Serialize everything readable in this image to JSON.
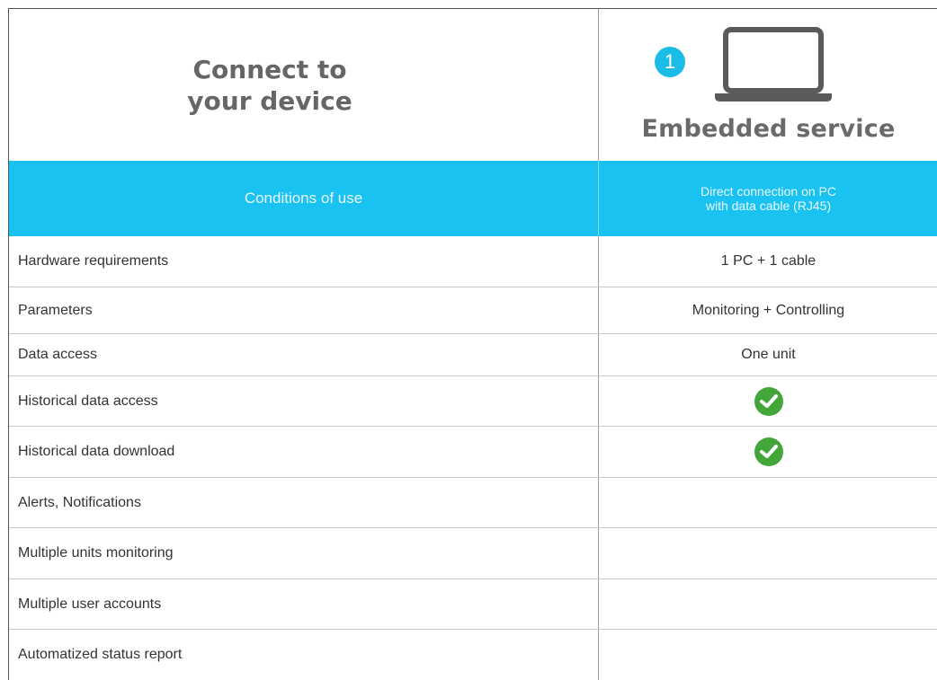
{
  "header": {
    "title_line1": "Connect to",
    "title_line2": "your device",
    "badge_number": "1",
    "service_title": "Embedded service",
    "service_icon": "laptop-icon",
    "accent_color": "#1ac2f1"
  },
  "conditions": {
    "label": "Conditions of use",
    "value_line1": "Direct connection on PC",
    "value_line2": "with data cable (RJ45)"
  },
  "rows": [
    {
      "label": "Hardware requirements",
      "value": "1 PC + 1 cable"
    },
    {
      "label": "Parameters",
      "value": "Monitoring + Controlling"
    },
    {
      "label": "Data access",
      "value": "One unit"
    },
    {
      "label": "Historical data access",
      "value": "",
      "check": true
    },
    {
      "label": "Historical data download",
      "value": "",
      "check": true
    },
    {
      "label": "Alerts, Notifications",
      "value": ""
    },
    {
      "label": "Multiple units monitoring",
      "value": ""
    },
    {
      "label": "Multiple user accounts",
      "value": ""
    },
    {
      "label": "Automatized status report",
      "value": ""
    }
  ],
  "check_icon": "check-circle-icon",
  "check_color": "#43a63a"
}
